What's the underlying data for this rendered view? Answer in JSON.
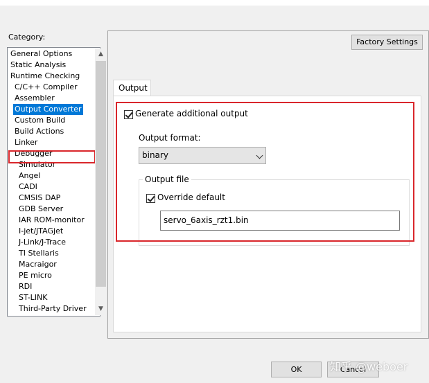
{
  "category": {
    "label": "Category:",
    "items": [
      {
        "label": "General Options",
        "indent": 0
      },
      {
        "label": "Static Analysis",
        "indent": 0
      },
      {
        "label": "Runtime Checking",
        "indent": 0
      },
      {
        "label": "C/C++ Compiler",
        "indent": 1
      },
      {
        "label": "Assembler",
        "indent": 1
      },
      {
        "label": "Output Converter",
        "indent": 1,
        "selected": true
      },
      {
        "label": "Custom Build",
        "indent": 1
      },
      {
        "label": "Build Actions",
        "indent": 1
      },
      {
        "label": "Linker",
        "indent": 1
      },
      {
        "label": "Debugger",
        "indent": 1
      },
      {
        "label": "Simulator",
        "indent": 2
      },
      {
        "label": "Angel",
        "indent": 2
      },
      {
        "label": "CADI",
        "indent": 2
      },
      {
        "label": "CMSIS DAP",
        "indent": 2
      },
      {
        "label": "GDB Server",
        "indent": 2
      },
      {
        "label": "IAR ROM-monitor",
        "indent": 2
      },
      {
        "label": "I-jet/JTAGjet",
        "indent": 2
      },
      {
        "label": "J-Link/J-Trace",
        "indent": 2
      },
      {
        "label": "TI Stellaris",
        "indent": 2
      },
      {
        "label": "Macraigor",
        "indent": 2
      },
      {
        "label": "PE micro",
        "indent": 2
      },
      {
        "label": "RDI",
        "indent": 2
      },
      {
        "label": "ST-LINK",
        "indent": 2
      },
      {
        "label": "Third-Party Driver",
        "indent": 2
      }
    ]
  },
  "factory_settings_label": "Factory Settings",
  "tab": {
    "label": "Output"
  },
  "output": {
    "generate_label": "Generate additional output",
    "generate_checked": true,
    "format_label": "Output format:",
    "format_value": "binary",
    "file_group_label": "Output file",
    "override_label": "Override default",
    "override_checked": true,
    "file_name": "servo_6axis_rzt1.bin"
  },
  "buttons": {
    "ok": "OK",
    "cancel": "Cancel"
  },
  "watermark": "知乎 @weboer",
  "colors": {
    "selection": "#0078d7",
    "highlight_box": "#d9262b"
  },
  "icons": {
    "scroll_up": "chevron-up-icon",
    "scroll_down": "chevron-down-icon",
    "dropdown": "chevron-down-icon",
    "checkbox": "checkmark-icon"
  }
}
